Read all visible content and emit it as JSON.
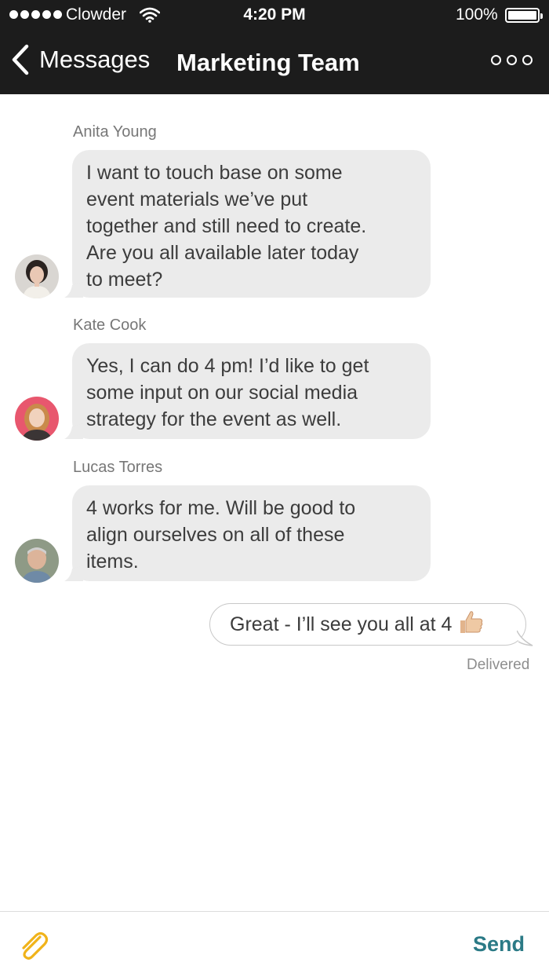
{
  "status_bar": {
    "carrier": "Clowder",
    "time": "4:20 PM",
    "battery": "100%"
  },
  "nav": {
    "back_label": "Messages",
    "title": "Marketing Team"
  },
  "messages": [
    {
      "sender": "Anita Young",
      "lines": [
        "I want to touch base on some",
        "event materials we’ve put",
        "together and still need to create.",
        "Are you all available later today",
        "to meet?"
      ]
    },
    {
      "sender": "Kate Cook",
      "lines": [
        "Yes, I can do 4 pm! I’d like to get",
        "some input on our social media",
        "strategy for the event as well."
      ]
    },
    {
      "sender": "Lucas Torres",
      "lines": [
        "4 works for me. Will be good to",
        "align ourselves on all of these",
        "items."
      ]
    }
  ],
  "outgoing": {
    "text": "Great - I’ll see you all at 4",
    "emoji": "thumbs-up",
    "status": "Delivered"
  },
  "composer": {
    "send_label": "Send",
    "attach_icon": "paperclip-icon"
  },
  "colors": {
    "nav_background": "#1c1c1c",
    "incoming_bubble": "#ebebeb",
    "send_accent": "#2b7a86",
    "attach_accent": "#f0b31a"
  }
}
